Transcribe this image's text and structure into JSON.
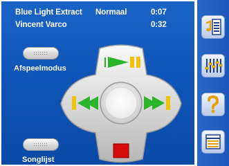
{
  "now_playing": [
    {
      "title": "Blue Light Extract",
      "mode": "Normaal",
      "time": "0:07"
    },
    {
      "title": "Vincent Varco",
      "mode": "",
      "time": "0:32"
    }
  ],
  "controls": {
    "play_mode_label": "Afspeelmodus",
    "playlist_label": "Songlijst"
  },
  "sidebar": [
    {
      "icon": "music-list-icon"
    },
    {
      "icon": "equalizer-icon"
    },
    {
      "icon": "help-icon"
    },
    {
      "icon": "list-icon"
    }
  ],
  "colors": {
    "background": "#1a63c6",
    "accent_green": "#2bb52b",
    "accent_yellow": "#f2c20b",
    "stop_red": "#d30b0b"
  }
}
